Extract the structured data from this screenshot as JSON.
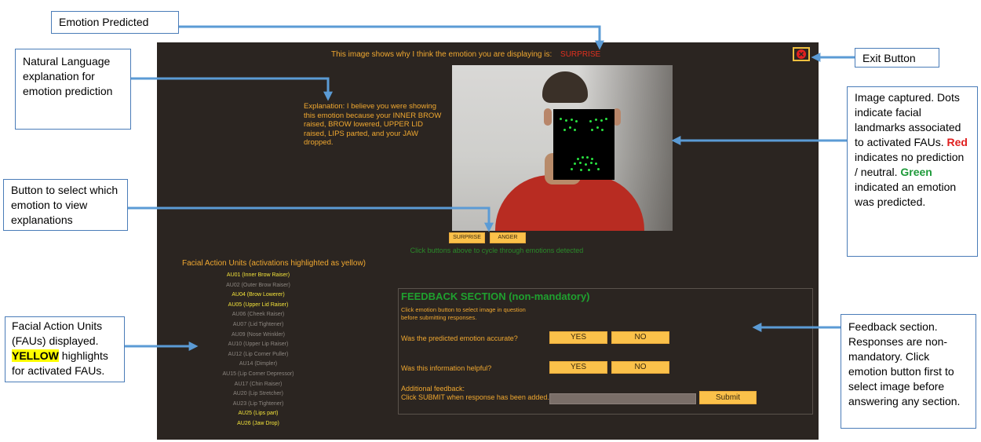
{
  "app": {
    "header_text": "This image shows why I think the emotion you are displaying is:",
    "predicted_emotion": "SURPRISE",
    "exit_icon": "exit-icon",
    "explanation": "Explanation: I believe you were showing this emotion because your INNER BROW raised, BROW lowered, UPPER LID raised, LIPS parted,  and your JAW dropped.",
    "emotion_buttons": [
      {
        "label": "SURPRISE"
      },
      {
        "label": "ANGER"
      }
    ],
    "cycle_hint": "Click buttons above to cycle through emotions detected",
    "fau_title": "Facial Action Units (activations highlighted as yellow)",
    "faus": [
      {
        "label": "AU01 (Inner Brow Raiser)",
        "active": true
      },
      {
        "label": "AU02 (Outer Brow Raiser)",
        "active": false
      },
      {
        "label": "AU04 (Brow Lowerer)",
        "active": true
      },
      {
        "label": "AU05 (Upper Lid Raiser)",
        "active": true
      },
      {
        "label": "AU06 (Cheek Raiser)",
        "active": false
      },
      {
        "label": "AU07 (Lid Tightener)",
        "active": false
      },
      {
        "label": "AU09 (Nose Wrinkler)",
        "active": false
      },
      {
        "label": "AU10 (Upper Lip Raiser)",
        "active": false
      },
      {
        "label": "AU12 (Lip Corner Puller)",
        "active": false
      },
      {
        "label": "AU14 (Dimpler)",
        "active": false
      },
      {
        "label": "AU15 (Lip Corner Depressor)",
        "active": false
      },
      {
        "label": "AU17 (Chin Raiser)",
        "active": false
      },
      {
        "label": "AU20 (Lip Stretcher)",
        "active": false
      },
      {
        "label": "AU23 (Lip Tightener)",
        "active": false
      },
      {
        "label": "AU25 (Lips part)",
        "active": true
      },
      {
        "label": "AU26 (Jaw Drop)",
        "active": true
      }
    ],
    "feedback": {
      "title": "FEEDBACK SECTION (non-mandatory)",
      "instruction": "Click emotion button to select image in question before submitting responses.",
      "q1": "Was the predicted emotion accurate?",
      "q2": "Was this information helpful?",
      "yes": "YES",
      "no": "NO",
      "additional_label": "Additional feedback:",
      "additional_hint": "Click SUBMIT when response has been added.",
      "submit": "Submit"
    }
  },
  "annotations": {
    "emotion_predicted": "Emotion Predicted",
    "nl_explanation": "Natural Language explanation for emotion prediction",
    "button_select": "Button to select which emotion to view explanations",
    "fau_pre": "Facial Action Units (FAUs) displayed.",
    "fau_yellow": "YELLOW",
    "fau_post": "highlights for activated FAUs.",
    "exit_button": "Exit Button",
    "image_captured": "Image captured. Dots indicate facial landmarks associated to activated FAUs.",
    "red_word": "Red",
    "red_text": "indicates no prediction / neutral.",
    "green_word": "Green",
    "green_text": "indicated an emotion was predicted.",
    "feedback_section": "Feedback section. Responses are non-mandatory. Click emotion button first to select image before answering any section."
  },
  "colors": {
    "app_bg": "#2b2521",
    "accent_orange": "#f0a830",
    "button_yellow": "#fbc14a",
    "active_fau": "#f2e23a",
    "inactive_fau": "#8c8680",
    "emotion_red": "#e0301f",
    "feedback_green": "#1fa12f",
    "arrow_blue": "#5b9bd5"
  }
}
